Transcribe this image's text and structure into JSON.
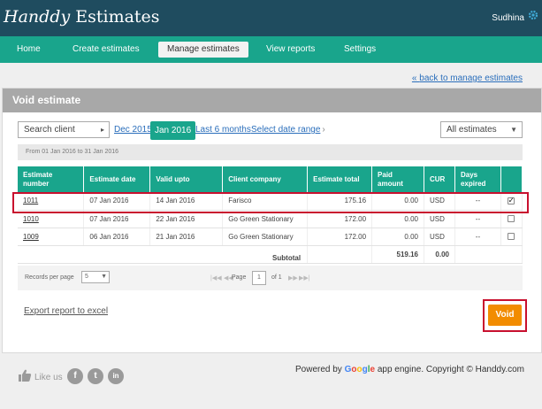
{
  "header": {
    "logo_script": "Handdy",
    "logo_text": "Estimates",
    "user_name": "Sudhina"
  },
  "nav": {
    "items": [
      {
        "label": "Home"
      },
      {
        "label": "Create estimates"
      },
      {
        "label": "Manage estimates",
        "active": true
      },
      {
        "label": "View reports"
      },
      {
        "label": "Settings"
      }
    ]
  },
  "back_link": "back to manage estimates",
  "panel": {
    "title": "Void estimate",
    "filters": {
      "client_select": "Search client",
      "period_links": [
        "Dec 2015",
        "Jan 2016",
        "Last 6 months",
        "Select date range"
      ],
      "active_period": "Jan 2016",
      "estimates_select": "All estimates"
    },
    "range_text": "From 01 Jan 2016 to 31 Jan 2016",
    "table": {
      "headers": [
        "Estimate number",
        "Estimate date",
        "Valid upto",
        "Client company",
        "Estimate total",
        "Paid amount",
        "CUR",
        "Days expired",
        ""
      ],
      "rows": [
        {
          "number": "1011",
          "date": "07 Jan 2016",
          "valid": "14 Jan 2016",
          "client": "Farisco",
          "total": "175.16",
          "paid": "0.00",
          "cur": "USD",
          "expired": "--",
          "checked": true
        },
        {
          "number": "1010",
          "date": "07 Jan 2016",
          "valid": "22 Jan 2016",
          "client": "Go Green Stationary",
          "total": "172.00",
          "paid": "0.00",
          "cur": "USD",
          "expired": "--",
          "checked": false
        },
        {
          "number": "1009",
          "date": "06 Jan 2016",
          "valid": "21 Jan 2016",
          "client": "Go Green Stationary",
          "total": "172.00",
          "paid": "0.00",
          "cur": "USD",
          "expired": "--",
          "checked": false
        }
      ],
      "subtotal_label": "Subtotal",
      "subtotal_total": "519.16",
      "subtotal_paid": "0.00"
    },
    "pager": {
      "records_label": "Records per page",
      "records_value": "5",
      "page_label": "Page",
      "page_value": "1",
      "of_label": "of 1"
    },
    "export_link": "Export report to excel",
    "void_button": "Void"
  },
  "footer": {
    "like_us": "Like us",
    "social": [
      "f",
      "t",
      "in"
    ],
    "powered_prefix": "Powered by",
    "google": [
      "G",
      "o",
      "o",
      "g",
      "l",
      "e"
    ],
    "powered_suffix": "app engine. Copyright © Handdy.com"
  },
  "colors": {
    "topbar": "#1f4c5f",
    "accent": "#19a58c",
    "void_button": "#f28c00",
    "highlight": "#c8102e"
  }
}
